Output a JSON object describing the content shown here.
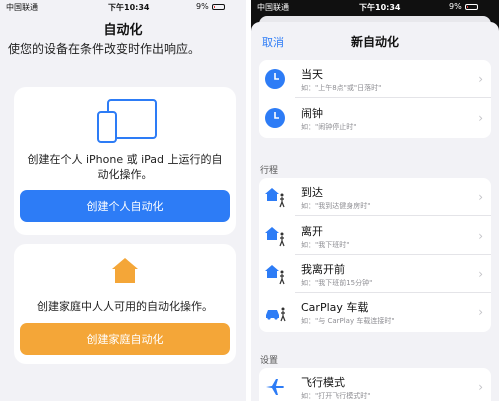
{
  "left": {
    "status": {
      "carrier": "中国联通",
      "time": "下午10:34",
      "battery": "9%"
    },
    "title": "自动化",
    "subtitle": "使您的设备在条件改变时作出响应。",
    "personal_card": {
      "text": "创建在个人 iPhone 或 iPad 上运行的自动化操作。",
      "button": "创建个人自动化"
    },
    "home_card": {
      "text": "创建家庭中人人可用的自动化操作。",
      "button": "创建家庭自动化"
    }
  },
  "right": {
    "status": {
      "carrier": "中国联通",
      "time": "下午10:34",
      "battery": "9%"
    },
    "cancel": "取消",
    "title": "新自动化",
    "time_group": [
      {
        "icon": "clock-icon",
        "title": "当天",
        "subtitle": "如：\"上午8点\"或\"日落时\""
      },
      {
        "icon": "clock-icon",
        "title": "闹钟",
        "subtitle": "如：\"闹钟停止时\""
      }
    ],
    "travel_header": "行程",
    "travel_group": [
      {
        "icon": "home-walk-icon",
        "title": "到达",
        "subtitle": "如：\"我到达健身房时\""
      },
      {
        "icon": "home-walk-icon",
        "title": "离开",
        "subtitle": "如：\"我下班时\""
      },
      {
        "icon": "home-walk-icon",
        "title": "我离开前",
        "subtitle": "如：\"我下班前15分钟\""
      },
      {
        "icon": "car-walk-icon",
        "title": "CarPlay 车载",
        "subtitle": "如：\"与 CarPlay 车载连接时\""
      }
    ],
    "settings_header": "设置",
    "settings_group": [
      {
        "icon": "airplane-icon",
        "title": "飞行模式",
        "subtitle": "如：\"打开飞行模式时\""
      }
    ]
  },
  "colors": {
    "blue": "#2d7cf6",
    "orange": "#f4a638"
  }
}
